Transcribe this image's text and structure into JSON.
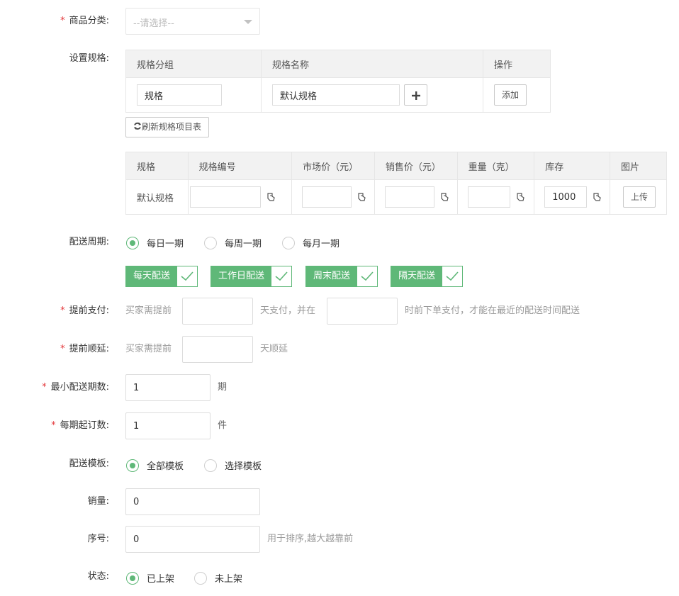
{
  "category": {
    "label": "商品分类:",
    "placeholder": "--请选择--"
  },
  "spec": {
    "label": "设置规格:",
    "headers": [
      "规格分组",
      "规格名称",
      "操作"
    ],
    "group_value": "规格",
    "name_value": "默认规格",
    "add_label": "添加",
    "refresh_label": "刷新规格项目表"
  },
  "items_table": {
    "headers": [
      "规格",
      "规格编号",
      "市场价（元）",
      "销售价（元）",
      "重量（克）",
      "库存",
      "图片"
    ],
    "row": {
      "spec": "默认规格",
      "code": "",
      "market_price": "",
      "sale_price": "",
      "weight": "",
      "stock": "1000",
      "upload_label": "上传"
    }
  },
  "delivery_cycle": {
    "label": "配送周期:",
    "options": [
      "每日一期",
      "每周一期",
      "每月一期"
    ],
    "selected": 0,
    "tags": [
      "每天配送",
      "工作日配送",
      "周末配送",
      "隔天配送"
    ]
  },
  "prepay": {
    "label": "提前支付:",
    "text1": "买家需提前",
    "text2": "天支付，并在",
    "text3": "时前下单支付，才能在最近的配送时间配送"
  },
  "delay": {
    "label": "提前顺延:",
    "text1": "买家需提前",
    "text2": "天顺延"
  },
  "min_periods": {
    "label": "最小配送期数:",
    "value": "1",
    "unit": "期"
  },
  "min_qty": {
    "label": "每期起订数:",
    "value": "1",
    "unit": "件"
  },
  "template": {
    "label": "配送模板:",
    "options": [
      "全部模板",
      "选择模板"
    ],
    "selected": 0
  },
  "sales": {
    "label": "销量:",
    "value": "0"
  },
  "order": {
    "label": "序号:",
    "value": "0",
    "hint": "用于排序,越大越靠前"
  },
  "status": {
    "label": "状态:",
    "options": [
      "已上架",
      "未上架"
    ],
    "selected": 0
  },
  "colors": {
    "accent": "#5fb878",
    "required": "#e4393c"
  }
}
